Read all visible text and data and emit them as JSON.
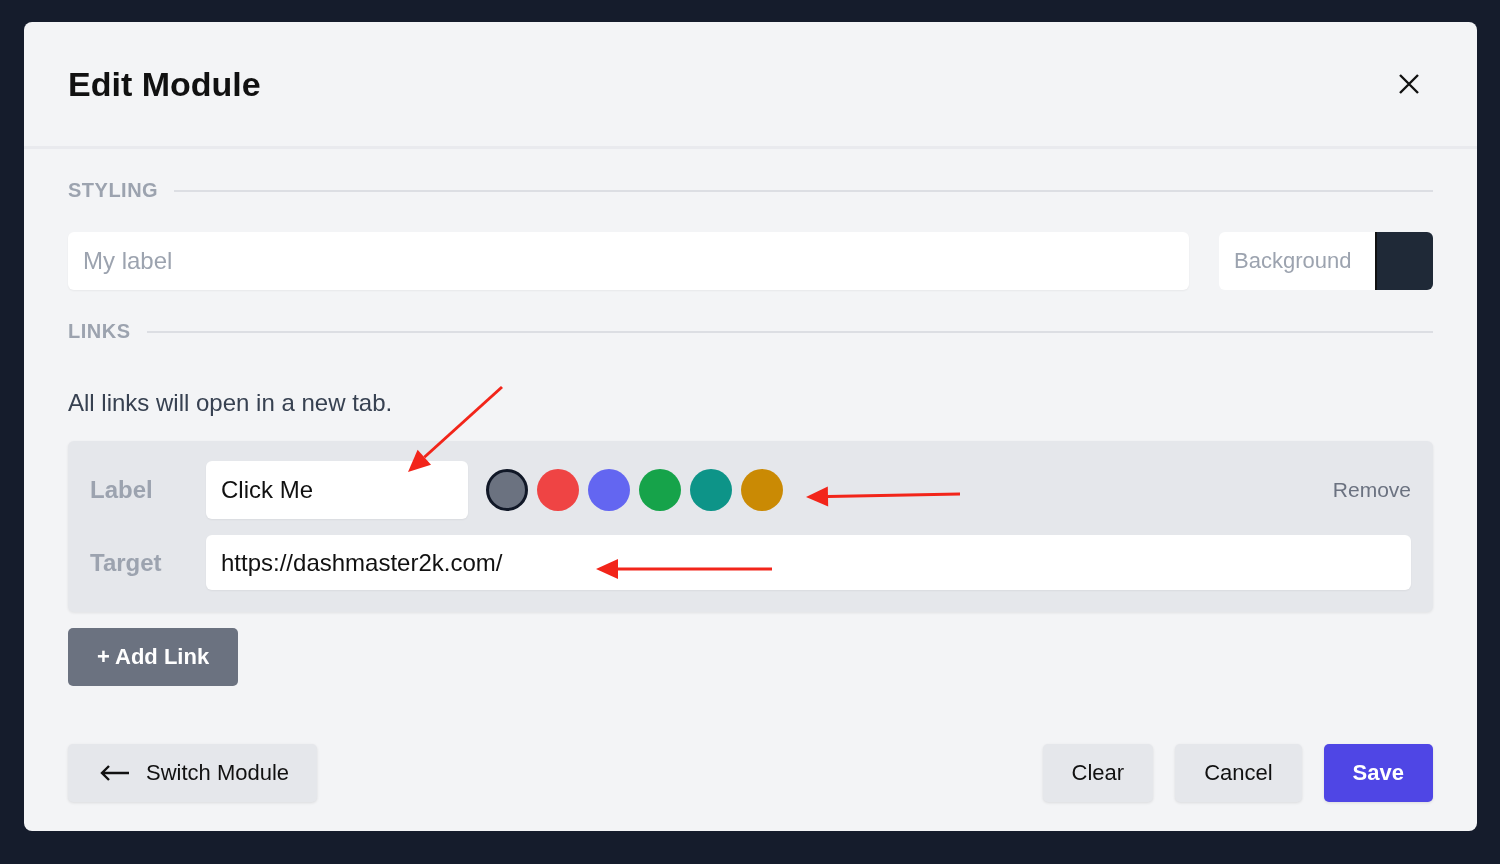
{
  "dialog": {
    "title": "Edit Module"
  },
  "styling": {
    "heading": "STYLING",
    "label_placeholder": "My label",
    "background": {
      "placeholder": "Background",
      "color": "#1f2937"
    }
  },
  "links": {
    "heading": "LINKS",
    "note": "All links will open in a new tab.",
    "items": [
      {
        "label_caption": "Label",
        "label_value": "Click Me",
        "target_caption": "Target",
        "target_value": "https://dashmaster2k.com/",
        "remove": "Remove",
        "swatches": [
          {
            "color": "#6b7280",
            "selected": true
          },
          {
            "color": "#ef4444",
            "selected": false
          },
          {
            "color": "#6366f1",
            "selected": false
          },
          {
            "color": "#16a34a",
            "selected": false
          },
          {
            "color": "#0d9488",
            "selected": false
          },
          {
            "color": "#ca8a04",
            "selected": false
          }
        ]
      }
    ],
    "add_button": "+ Add Link"
  },
  "footer": {
    "switch_button": "Switch Module",
    "buttons": [
      {
        "label": "Clear",
        "kind": "secondary"
      },
      {
        "label": "Cancel",
        "kind": "secondary"
      },
      {
        "label": "Save",
        "kind": "primary"
      }
    ]
  }
}
